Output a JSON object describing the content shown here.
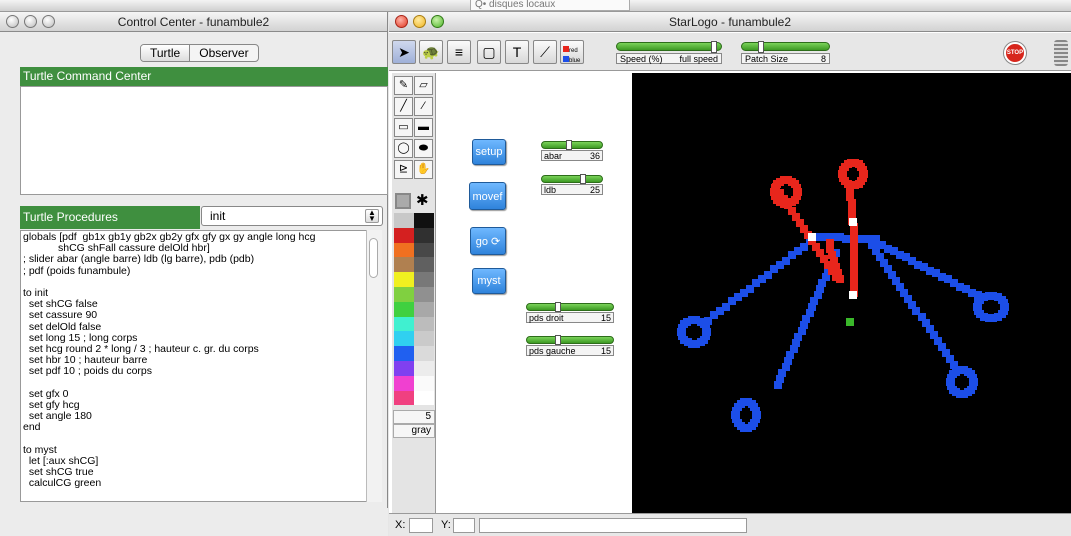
{
  "desktop": {
    "search_text": "Q• disques locaux"
  },
  "control_center": {
    "title": "Control Center - funambule2",
    "tabs": [
      "Turtle",
      "Observer"
    ],
    "command_center_label": "Turtle Command Center",
    "procedures_label": "Turtle Procedures",
    "procedure_selected": "init",
    "code": "globals [pdf  gb1x gb1y gb2x gb2y gfx gfy gx gy angle long hcg\n            shCG shFall cassure delOld hbr]\n; slider abar (angle barre) ldb (lg barre), pdb (pdb)\n; pdf (poids funambule)\n\nto init\n  set shCG false\n  set cassure 90\n  set delOld false\n  set long 15 ; long corps\n  set hcg round 2 * long / 3 ; hauteur c. gr. du corps\n  set hbr 10 ; hauteur barre\n  set pdf 10 ; poids du corps\n\n  set gfx 0\n  set gfy hcg\n  set angle 180\nend\n\nto myst\n  let [:aux shCG]\n  set shCG true\n  calculCG green"
  },
  "starlogo": {
    "title": "StarLogo - funambule2",
    "toolbar": {
      "text_tool": "T",
      "speed_slider": {
        "label": "Speed (%)",
        "value": "full speed",
        "level": 0.98
      },
      "patch_slider": {
        "label": "Patch Size",
        "value": "8",
        "level": 0.2
      },
      "stop_label": "STOP",
      "legend_red": "red",
      "legend_blue": "blue"
    },
    "palette": {
      "swatch_colors": [
        "#c8c8c8",
        "#101010",
        "#d42020",
        "#303030",
        "#f07020",
        "#484848",
        "#b08050",
        "#606060",
        "#f0f020",
        "#787878",
        "#80d040",
        "#909090",
        "#40d040",
        "#a8a8a8",
        "#40f0d0",
        "#bcbcbc",
        "#30d0f0",
        "#cacaca",
        "#2060f0",
        "#dadada",
        "#8040f0",
        "#ececec",
        "#f040d0",
        "#fafafa",
        "#f04080",
        "#ffffff"
      ],
      "number": "5",
      "color_name": "gray"
    },
    "buttons": {
      "setup": "setup",
      "movef": "movef",
      "go": "go",
      "myst": "myst"
    },
    "sliders": [
      {
        "id": "abar",
        "label": "abar",
        "value": "36",
        "level": 0.45
      },
      {
        "id": "ldb",
        "label": "ldb",
        "value": "25",
        "level": 0.7
      },
      {
        "id": "pds-droit",
        "label": "pds droit",
        "value": "15",
        "level": 0.35
      },
      {
        "id": "pds-gauche",
        "label": "pds gauche",
        "value": "15",
        "level": 0.35
      }
    ],
    "status": {
      "x_label": "X:",
      "y_label": "Y:"
    },
    "colors": {
      "red": "#e8261c",
      "blue": "#1c4ee8",
      "white": "#ffffff",
      "green": "#3ab82a",
      "world_bg": "#000000"
    }
  }
}
